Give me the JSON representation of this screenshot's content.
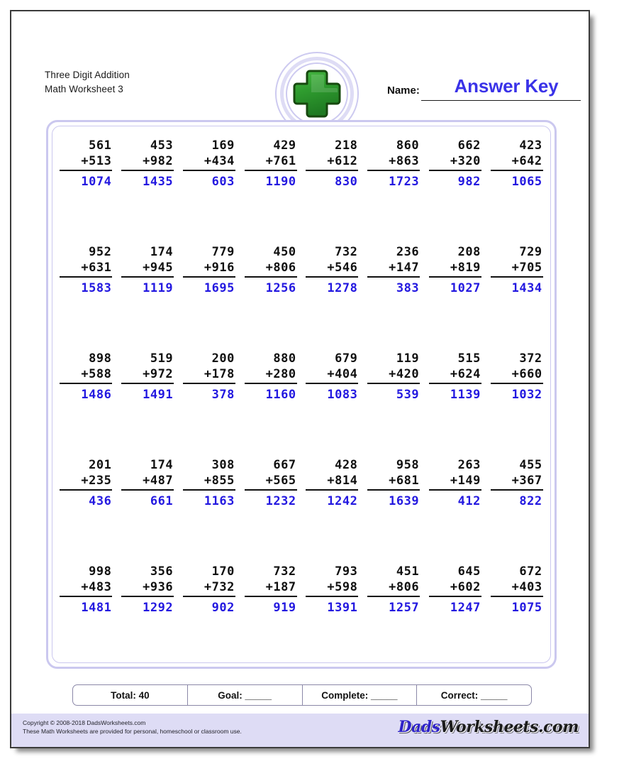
{
  "header": {
    "title_line1": "Three Digit Addition",
    "title_line2": "Math Worksheet 3",
    "name_label": "Name:",
    "answer_key_label": "Answer Key",
    "logo_icon": "green-plus-icon"
  },
  "colors": {
    "answer_blue": "#2318e0",
    "answer_key_blue": "#3a32e8",
    "panel_border": "#cbc8ef",
    "footer_band": "#dedcf5",
    "plus_green": "#2f9c2f",
    "plus_green_dark": "#1d5c18"
  },
  "problems": [
    [
      {
        "top": "561",
        "bottom": "+513",
        "answer": "1074"
      },
      {
        "top": "453",
        "bottom": "+982",
        "answer": "1435"
      },
      {
        "top": "169",
        "bottom": "+434",
        "answer": "603"
      },
      {
        "top": "429",
        "bottom": "+761",
        "answer": "1190"
      },
      {
        "top": "218",
        "bottom": "+612",
        "answer": "830"
      },
      {
        "top": "860",
        "bottom": "+863",
        "answer": "1723"
      },
      {
        "top": "662",
        "bottom": "+320",
        "answer": "982"
      },
      {
        "top": "423",
        "bottom": "+642",
        "answer": "1065"
      }
    ],
    [
      {
        "top": "952",
        "bottom": "+631",
        "answer": "1583"
      },
      {
        "top": "174",
        "bottom": "+945",
        "answer": "1119"
      },
      {
        "top": "779",
        "bottom": "+916",
        "answer": "1695"
      },
      {
        "top": "450",
        "bottom": "+806",
        "answer": "1256"
      },
      {
        "top": "732",
        "bottom": "+546",
        "answer": "1278"
      },
      {
        "top": "236",
        "bottom": "+147",
        "answer": "383"
      },
      {
        "top": "208",
        "bottom": "+819",
        "answer": "1027"
      },
      {
        "top": "729",
        "bottom": "+705",
        "answer": "1434"
      }
    ],
    [
      {
        "top": "898",
        "bottom": "+588",
        "answer": "1486"
      },
      {
        "top": "519",
        "bottom": "+972",
        "answer": "1491"
      },
      {
        "top": "200",
        "bottom": "+178",
        "answer": "378"
      },
      {
        "top": "880",
        "bottom": "+280",
        "answer": "1160"
      },
      {
        "top": "679",
        "bottom": "+404",
        "answer": "1083"
      },
      {
        "top": "119",
        "bottom": "+420",
        "answer": "539"
      },
      {
        "top": "515",
        "bottom": "+624",
        "answer": "1139"
      },
      {
        "top": "372",
        "bottom": "+660",
        "answer": "1032"
      }
    ],
    [
      {
        "top": "201",
        "bottom": "+235",
        "answer": "436"
      },
      {
        "top": "174",
        "bottom": "+487",
        "answer": "661"
      },
      {
        "top": "308",
        "bottom": "+855",
        "answer": "1163"
      },
      {
        "top": "667",
        "bottom": "+565",
        "answer": "1232"
      },
      {
        "top": "428",
        "bottom": "+814",
        "answer": "1242"
      },
      {
        "top": "958",
        "bottom": "+681",
        "answer": "1639"
      },
      {
        "top": "263",
        "bottom": "+149",
        "answer": "412"
      },
      {
        "top": "455",
        "bottom": "+367",
        "answer": "822"
      }
    ],
    [
      {
        "top": "998",
        "bottom": "+483",
        "answer": "1481"
      },
      {
        "top": "356",
        "bottom": "+936",
        "answer": "1292"
      },
      {
        "top": "170",
        "bottom": "+732",
        "answer": "902"
      },
      {
        "top": "732",
        "bottom": "+187",
        "answer": "919"
      },
      {
        "top": "793",
        "bottom": "+598",
        "answer": "1391"
      },
      {
        "top": "451",
        "bottom": "+806",
        "answer": "1257"
      },
      {
        "top": "645",
        "bottom": "+602",
        "answer": "1247"
      },
      {
        "top": "672",
        "bottom": "+403",
        "answer": "1075"
      }
    ]
  ],
  "totals": {
    "total": "Total: 40",
    "goal": "Goal: _____",
    "complete": "Complete: _____",
    "correct": "Correct: _____"
  },
  "footer": {
    "copyright_line1": "Copyright © 2008-2018 DadsWorksheets.com",
    "copyright_line2": "These Math Worksheets are provided for personal, homeschool or classroom use.",
    "brand_part1": "Dads",
    "brand_part2": "Worksheets.com"
  }
}
